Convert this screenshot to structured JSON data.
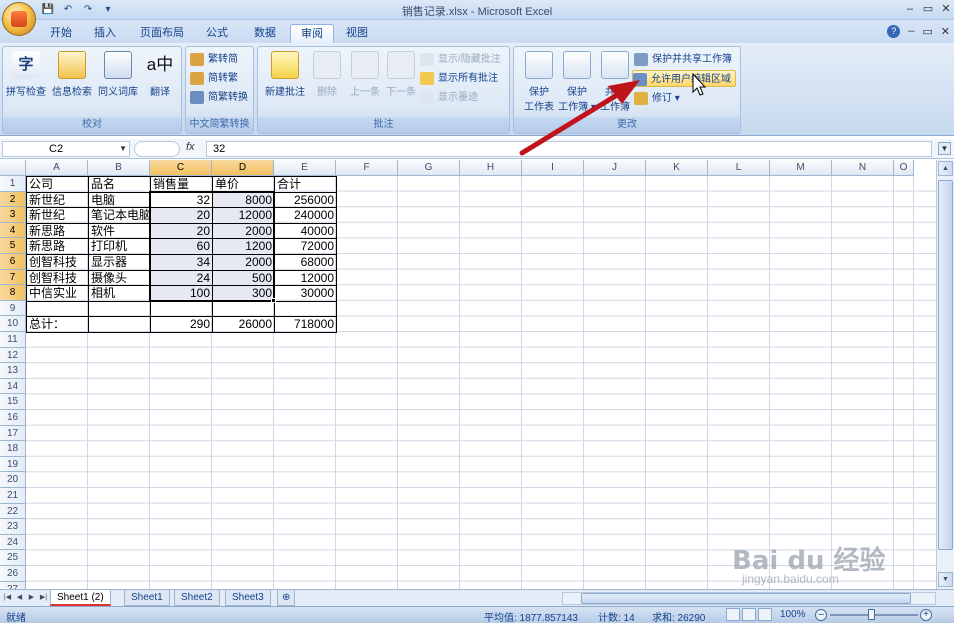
{
  "window": {
    "title": "销售记录.xlsx - Microsoft Excel",
    "controls": [
      "–",
      "▭",
      "✕"
    ]
  },
  "qat": {
    "save": "💾",
    "undo": "↶",
    "redo": "↷",
    "more": "▾"
  },
  "tabs": [
    "开始",
    "插入",
    "页面布局",
    "公式",
    "数据",
    "审阅",
    "视图"
  ],
  "active_tab": "审阅",
  "ribbon": {
    "proofing": {
      "label": "校对",
      "buttons": [
        "拼写检查",
        "信息检索",
        "同义词库",
        "翻译"
      ]
    },
    "chinese": {
      "label": "中文简繁转换",
      "buttons": [
        "繁转简",
        "简转繁",
        "简繁转换"
      ]
    },
    "comments": {
      "label": "批注",
      "big": [
        "新建批注",
        "删除",
        "上一条",
        "下一条"
      ],
      "small": [
        "显示/隐藏批注",
        "显示所有批注",
        "显示墨迹"
      ]
    },
    "changes": {
      "label": "更改",
      "big": [
        "保护工作表",
        "保护工作簿",
        "共享工作簿"
      ],
      "big_lines": [
        [
          "保护",
          "工作表"
        ],
        [
          "保护",
          "工作簿 ▾"
        ],
        [
          "共享",
          "工作簿"
        ]
      ],
      "small": [
        "保护并共享工作簿",
        "允许用户编辑区域",
        "修订 ▾"
      ]
    }
  },
  "formula_bar": {
    "name_box": "C2",
    "fx": "fx",
    "value": "32"
  },
  "columns": [
    "A",
    "B",
    "C",
    "D",
    "E",
    "F",
    "G",
    "H",
    "I",
    "J",
    "K",
    "L",
    "M",
    "N",
    "O"
  ],
  "rows": [
    "1",
    "2",
    "3",
    "4",
    "5",
    "6",
    "7",
    "8",
    "9",
    "10",
    "11",
    "12",
    "13",
    "14",
    "15",
    "16",
    "17",
    "18",
    "19",
    "20",
    "21",
    "22",
    "23",
    "24",
    "25",
    "26",
    "27"
  ],
  "table": {
    "headers": [
      "公司",
      "品名",
      "销售量",
      "单价",
      "合计"
    ],
    "data": [
      [
        "新世纪",
        "电脑",
        "32",
        "8000",
        "256000"
      ],
      [
        "新世纪",
        "笔记本电脑",
        "20",
        "12000",
        "240000"
      ],
      [
        "新思路",
        "软件",
        "20",
        "2000",
        "40000"
      ],
      [
        "新思路",
        "打印机",
        "60",
        "1200",
        "72000"
      ],
      [
        "创智科技",
        "显示器",
        "34",
        "2000",
        "68000"
      ],
      [
        "创智科技",
        "摄像头",
        "24",
        "500",
        "12000"
      ],
      [
        "中信实业",
        "相机",
        "100",
        "300",
        "30000"
      ],
      [
        "",
        "",
        "",
        "",
        ""
      ],
      [
        "总计：",
        "",
        "290",
        "26000",
        "718000"
      ]
    ]
  },
  "sheets": [
    "Sheet1 (2)",
    "Sheet1",
    "Sheet2",
    "Sheet3"
  ],
  "active_sheet": "Sheet1 (2)",
  "status": {
    "mode": "就绪",
    "average": "平均值: 1877.857143",
    "count": "计数: 14",
    "sum": "求和: 26290",
    "zoom": "100%"
  },
  "watermark": {
    "main": "Bai du 经验",
    "sub": "jingyan.baidu.com"
  },
  "colors": {
    "accent": "#15428b",
    "selection": "#f1c15f",
    "arrow": "#c0141c"
  }
}
